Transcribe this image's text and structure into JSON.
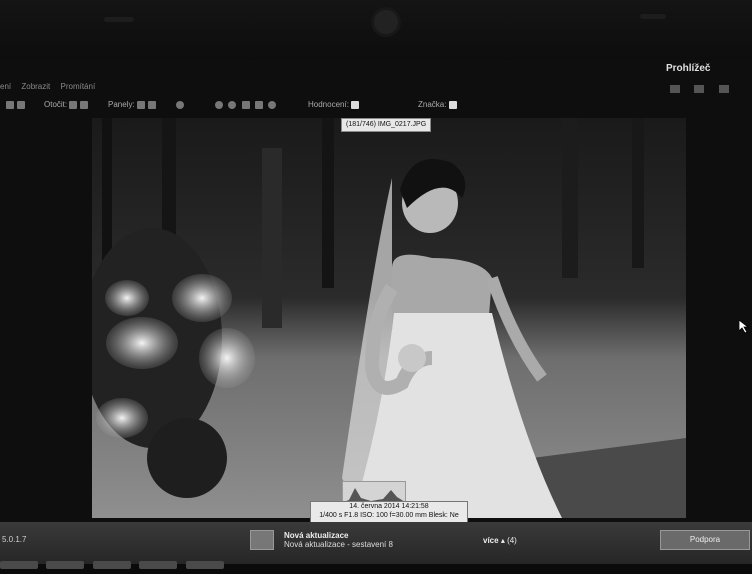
{
  "menu": {
    "items": [
      "ení",
      "Zobrazit",
      "Promítání"
    ]
  },
  "header": {
    "title": "Prohlížeč"
  },
  "toolbar": {
    "rotate_label": "Otočit:",
    "panels_label": "Panely:",
    "rating_label": "Hodnocení:",
    "tag_label": "Značka:"
  },
  "photo": {
    "tooltip": "(181/746) IMG_0217.JPG"
  },
  "info": {
    "line1": "14. června 2014 14:21:58",
    "line2": "1/400 s F1.8 ISO: 100 f=30.00 mm Blesk: Ne"
  },
  "taskbar": {
    "version": "5.0.1.7",
    "update_title": "Nová aktualizace",
    "update_sub": "Nová aktualizace - sestavení 8",
    "more_label": "více",
    "more_count": "(4)",
    "support_label": "Podpora"
  }
}
